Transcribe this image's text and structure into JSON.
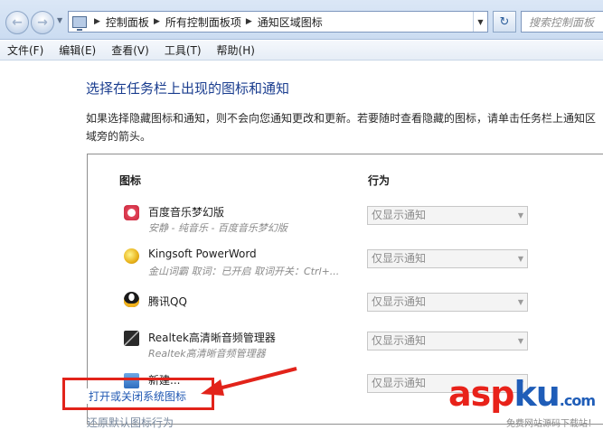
{
  "address_bar": {
    "breadcrumbs": [
      "控制面板",
      "所有控制面板项",
      "通知区域图标"
    ],
    "search_placeholder": "搜索控制面板"
  },
  "menu": {
    "items": [
      "文件(F)",
      "编辑(E)",
      "查看(V)",
      "工具(T)",
      "帮助(H)"
    ]
  },
  "page": {
    "title": "选择在任务栏上出现的图标和通知",
    "description": "如果选择隐藏图标和通知，则不会向您通知更改和更新。若要随时查看隐藏的图标，请单击任务栏上通知区域旁的箭头。"
  },
  "icon_list": {
    "col_icons": "图标",
    "col_behavior": "行为",
    "rows": [
      {
        "name": "百度音乐梦幻版",
        "subtitle": "安静 - 纯音乐 - 百度音乐梦幻版",
        "behavior": "仅显示通知",
        "icon": "baidu-music-icon"
      },
      {
        "name": "Kingsoft PowerWord",
        "subtitle": "金山词霸 取词：已开启 取词开关：Ctrl+...",
        "behavior": "仅显示通知",
        "icon": "kingsoft-powerword-icon"
      },
      {
        "name": "腾讯QQ",
        "subtitle": "",
        "behavior": "仅显示通知",
        "icon": "qq-penguin-icon"
      },
      {
        "name": "Realtek高清晰音频管理器",
        "subtitle": "Realtek高清晰音频管理器",
        "behavior": "仅显示通知",
        "icon": "realtek-audio-icon"
      },
      {
        "name": "新建...",
        "subtitle": "",
        "behavior": "仅显示通知",
        "icon": "new-item-icon"
      }
    ]
  },
  "links": {
    "system_icons": "打开或关闭系统图标",
    "restore_default": "还原默认图标行为"
  },
  "watermark": {
    "asp": "asp",
    "ku": "ku",
    "com": ".com",
    "subtitle": "免费网站源码下载站！"
  },
  "colors": {
    "title_blue": "#1a3d8f",
    "link_blue": "#2058b3",
    "annotation_red": "#e2231a"
  }
}
